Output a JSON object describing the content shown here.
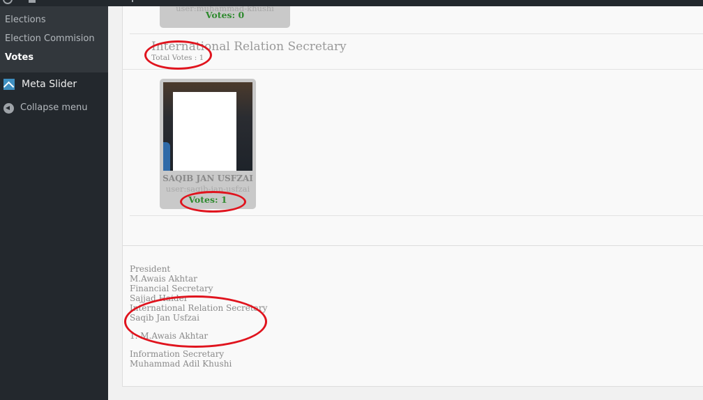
{
  "sidebar": {
    "submenu": [
      "Elections",
      "Election Commision",
      "Votes"
    ],
    "current": "Votes",
    "menu": [
      {
        "label": "Meta Slider",
        "icon": "meta-slider-icon"
      },
      {
        "label": "Collapse menu",
        "icon": "collapse-arrow-icon"
      }
    ]
  },
  "candidate_top": {
    "user": "user:muhammad-khushi",
    "votes": "Votes: 0"
  },
  "section": {
    "title": "International Relation Secretary",
    "total": "Total Votes : 1"
  },
  "candidate": {
    "name": "SAQIB JAN USFZAI",
    "user": "user:saqib-jan-usfzai",
    "votes": "Votes: 1"
  },
  "summary": [
    "President",
    "M.Awais Akhtar",
    "Financial Secretary",
    "Sajjad Haider",
    "International Relation Secretary",
    "Saqib Jan Usfzai",
    "1.  M.Awais Akhtar",
    "Information Secretary",
    "Muhammad Adil Khushi"
  ],
  "colors": {
    "sidebar_bg": "#23282d",
    "submenu_bg": "#32373c",
    "votes_green": "#2e8a2e",
    "annotation_red": "#e0141e"
  }
}
